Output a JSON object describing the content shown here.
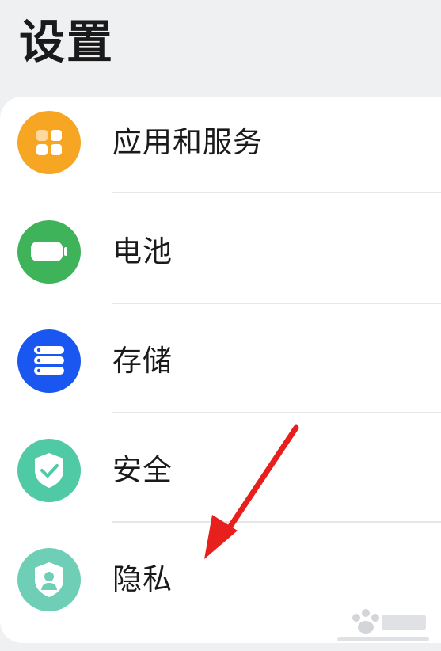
{
  "header": {
    "title": "设置"
  },
  "settings": {
    "items": [
      {
        "label": "应用和服务",
        "icon": "apps-icon",
        "color": "#f6a623"
      },
      {
        "label": "电池",
        "icon": "battery-icon",
        "color": "#3fb35a"
      },
      {
        "label": "存储",
        "icon": "storage-icon",
        "color": "#1a56f0"
      },
      {
        "label": "安全",
        "icon": "shield-icon",
        "color": "#4fcaa5"
      },
      {
        "label": "隐私",
        "icon": "privacy-icon",
        "color": "#6ecfb6"
      }
    ]
  },
  "annotation": {
    "color": "#e8201d"
  },
  "watermark": {
    "icon": "baidu-jingyan-logo"
  }
}
